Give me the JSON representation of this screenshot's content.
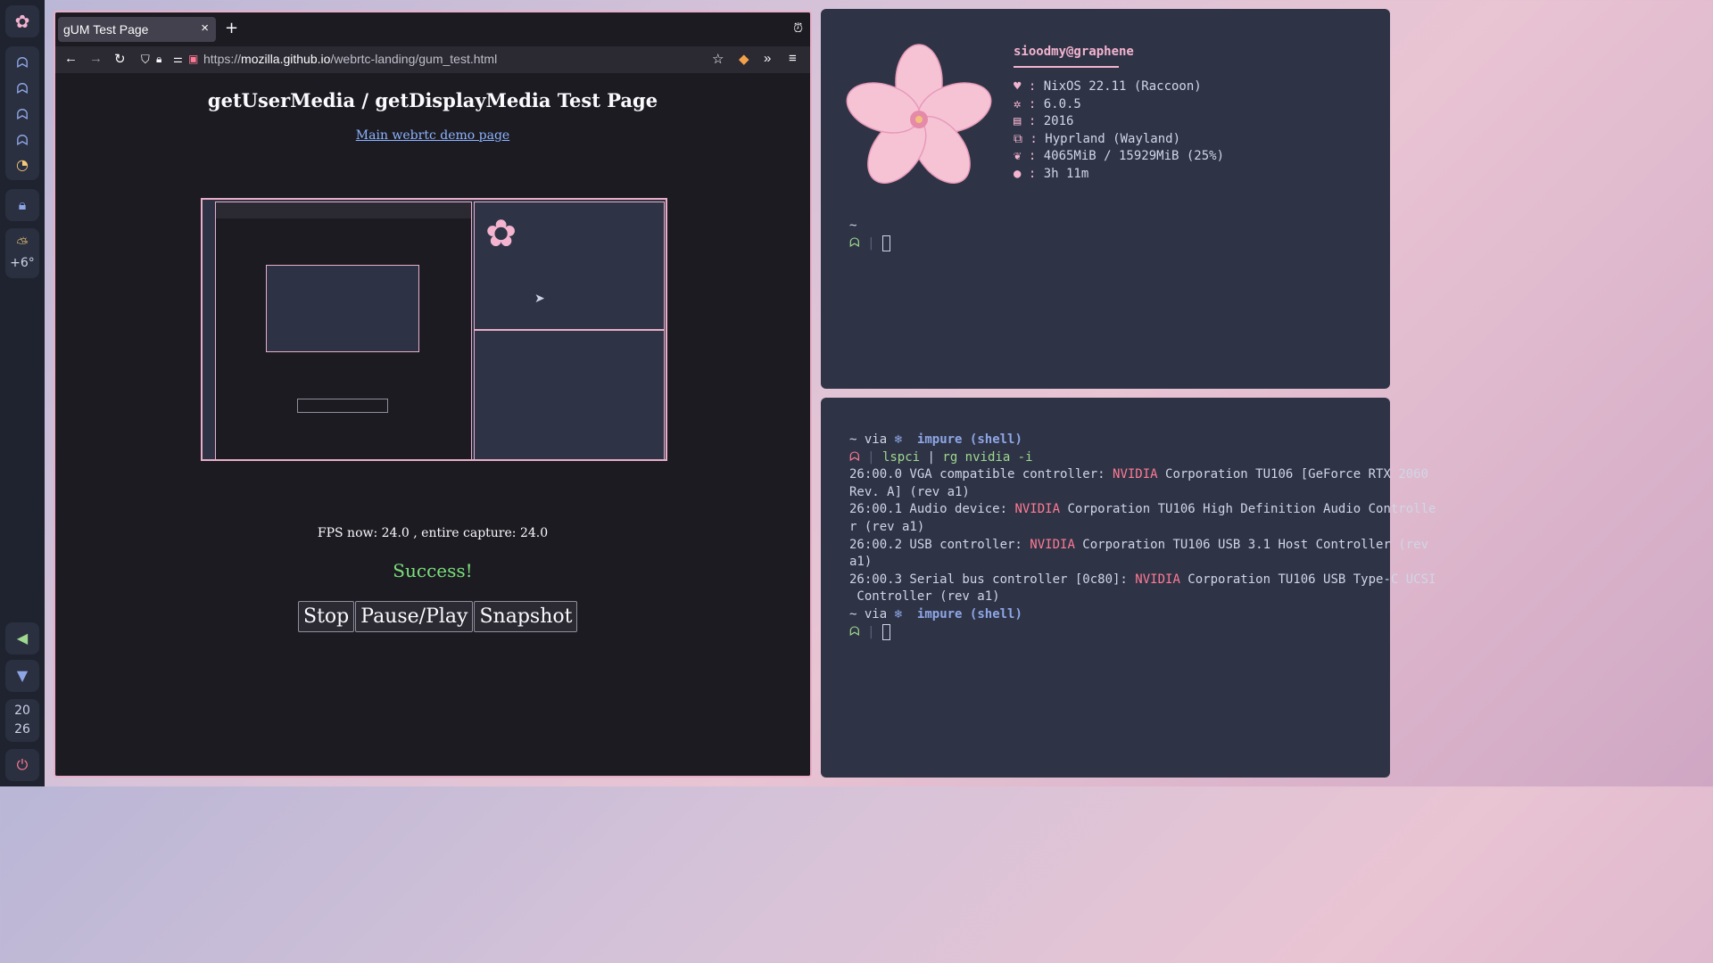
{
  "sidebar": {
    "weather_temp": "+6°",
    "clock_hours": "20",
    "clock_minutes": "26"
  },
  "browser": {
    "tab_title": "gUM Test Page",
    "url_scheme": "https://",
    "url_host": "mozilla.github.io",
    "url_path": "/webrtc-landing/gum_test.html",
    "page_title": "getUserMedia / getDisplayMedia Test Page",
    "demo_link": "Main webrtc demo page",
    "fps_text": "FPS now: 24.0 , entire capture: 24.0",
    "status_text": "Success!",
    "buttons": {
      "stop": "Stop",
      "pause": "Pause/Play",
      "snapshot": "Snapshot"
    }
  },
  "fetch": {
    "user": "sioodmy@graphene",
    "os": "NixOS 22.11 (Raccoon)",
    "kernel": "6.0.5",
    "packages": "2016",
    "wm": "Hyprland (Wayland)",
    "memory": "4065MiB / 15929MiB (25%)",
    "uptime": "3h 11m"
  },
  "terminal": {
    "prompt_dir": "~",
    "prompt_via": "via",
    "prompt_env": "impure (shell)",
    "command_1": "lspci",
    "command_2": "rg nvidia -i",
    "out_1a": "26:00.0 VGA compatible controller: ",
    "out_1b": " Corporation TU106 [GeForce RTX 2060",
    "out_1c": "Rev. A] (rev a1)",
    "out_2a": "26:00.1 Audio device: ",
    "out_2b": " Corporation TU106 High Definition Audio Controlle",
    "out_2c": "r (rev a1)",
    "out_3a": "26:00.2 USB controller: ",
    "out_3b": " Corporation TU106 USB 3.1 Host Controller (rev",
    "out_3c": "a1)",
    "out_4a": "26:00.3 Serial bus controller [0c80]: ",
    "out_4b": " Corporation TU106 USB Type-C UCSI",
    "out_4c": " Controller (rev a1)",
    "vendor": "NVIDIA"
  },
  "colors": {
    "accent": "#f4b3cf",
    "nvidia": "#ff7a93",
    "success": "#7be07b",
    "link": "#8cb4ff"
  }
}
